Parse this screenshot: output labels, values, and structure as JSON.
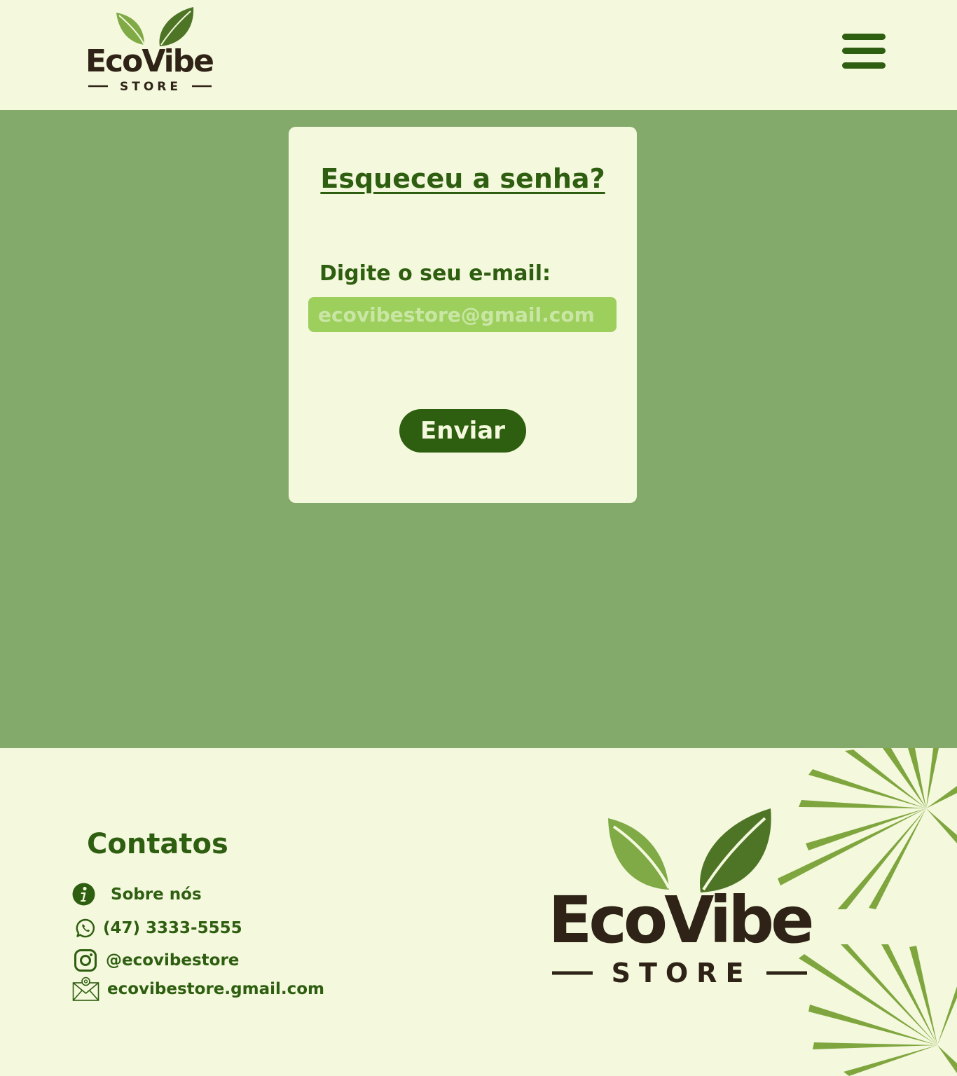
{
  "brand": {
    "name": "EcoVibe",
    "tagline": "STORE"
  },
  "header": {
    "menu_icon": "hamburger-menu-icon"
  },
  "forgot_password": {
    "title": "Esqueceu a senha?",
    "email_label": "Digite o seu e-mail:",
    "email_placeholder": "ecovibestore@gmail.com",
    "email_value": "",
    "submit_label": "Enviar"
  },
  "footer": {
    "contacts_title": "Contatos",
    "items": [
      {
        "icon": "info-icon",
        "label": "Sobre nós"
      },
      {
        "icon": "whatsapp-icon",
        "label": "(47) 3333-5555"
      },
      {
        "icon": "instagram-icon",
        "label": "@ecovibestore"
      },
      {
        "icon": "email-icon",
        "label": "ecovibestore.gmail.com"
      }
    ]
  },
  "colors": {
    "dark_green": "#2E5E10",
    "background_green": "#83AA6B",
    "cream": "#F4F8DC",
    "input_green": "#9DCF5D",
    "palm_green": "#7FA63E",
    "logo_brown": "#2E2316"
  }
}
